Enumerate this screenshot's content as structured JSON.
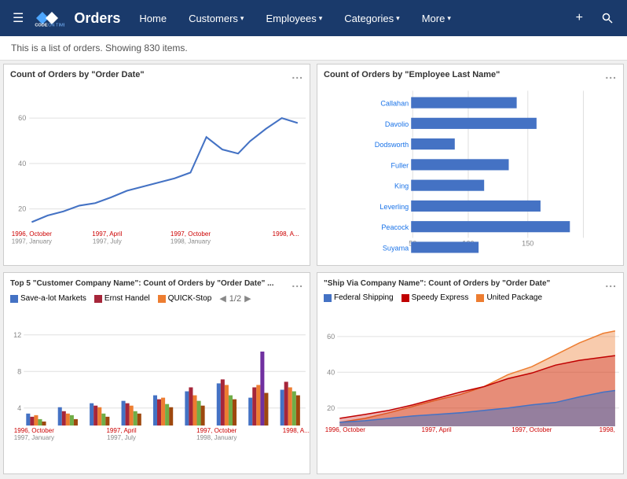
{
  "navbar": {
    "hamburger": "☰",
    "logo_text": "CODE ON TIME",
    "title": "Orders",
    "items": [
      {
        "label": "Home",
        "active": false,
        "has_dropdown": false
      },
      {
        "label": "Customers",
        "active": false,
        "has_dropdown": true
      },
      {
        "label": "Employees",
        "active": false,
        "has_dropdown": true
      },
      {
        "label": "Categories",
        "active": false,
        "has_dropdown": true
      },
      {
        "label": "More",
        "active": false,
        "has_dropdown": true
      }
    ],
    "add_icon": "+",
    "search_icon": "🔍"
  },
  "subheader": {
    "text": "This is a list of orders. Showing 830 items."
  },
  "chart1": {
    "title": "Count of Orders by \"Order Date\"",
    "dots": "...",
    "y_labels": [
      "60",
      "40",
      "20"
    ],
    "x_labels": [
      "1996, October",
      "1997, January",
      "1997, April",
      "1997, July",
      "1997, October",
      "1998, January",
      "1998, A..."
    ]
  },
  "chart2": {
    "title": "Count of Orders by \"Employee Last Name\"",
    "dots": "...",
    "employees": [
      {
        "name": "Callahan",
        "value": 104,
        "max": 160
      },
      {
        "name": "Davolio",
        "value": 123,
        "max": 160
      },
      {
        "name": "Dodsworth",
        "value": 43,
        "max": 160
      },
      {
        "name": "Fuller",
        "value": 96,
        "max": 160
      },
      {
        "name": "King",
        "value": 72,
        "max": 160
      },
      {
        "name": "Leverling",
        "value": 127,
        "max": 160
      },
      {
        "name": "Peacock",
        "value": 156,
        "max": 160
      },
      {
        "name": "Suyama",
        "value": 67,
        "max": 160
      }
    ],
    "axis_labels": [
      "50",
      "100",
      "150"
    ]
  },
  "chart3": {
    "title": "Top 5 \"Customer Company Name\": Count of Orders by \"Order Date\" ...",
    "dots": "...",
    "pagination": "1/2",
    "legend": [
      {
        "label": "Save-a-lot Markets",
        "color": "#4472C4"
      },
      {
        "label": "Ernst Handel",
        "color": "#A6263A"
      },
      {
        "label": "QUICK-Stop",
        "color": "#ED7D31"
      }
    ],
    "y_labels": [
      "12",
      "8",
      "4"
    ],
    "x_labels": [
      "1996, October",
      "1997, January",
      "1997, April",
      "1997, July",
      "1997, October",
      "1998, January",
      "1998, A..."
    ]
  },
  "chart4": {
    "title": "\"Ship Via Company Name\": Count of Orders by \"Order Date\"",
    "dots": "...",
    "legend": [
      {
        "label": "Federal Shipping",
        "color": "#4472C4"
      },
      {
        "label": "Speedy Express",
        "color": "#C00000"
      },
      {
        "label": "United Package",
        "color": "#ED7D31"
      }
    ],
    "y_labels": [
      "60",
      "40",
      "20"
    ],
    "x_labels": [
      "1996, October",
      "1997, April",
      "1997, October",
      "1998,"
    ]
  }
}
